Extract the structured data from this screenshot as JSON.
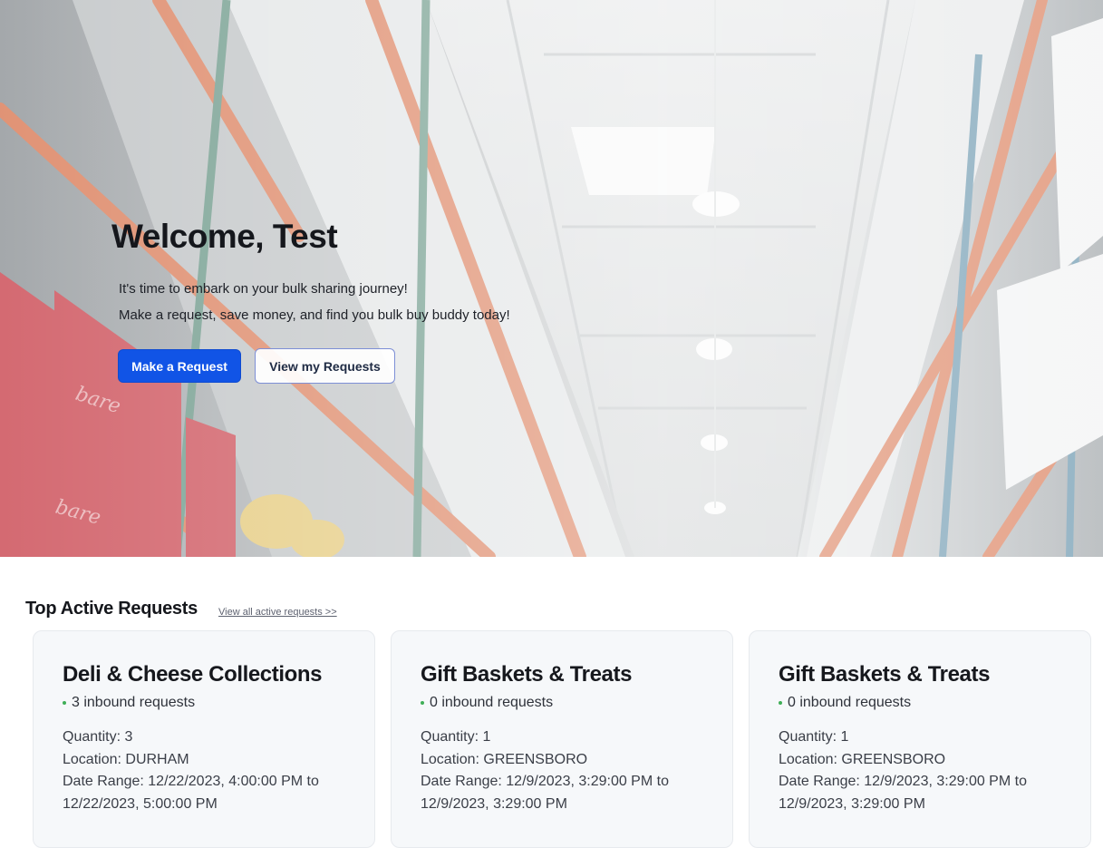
{
  "hero": {
    "welcome": "Welcome, Test",
    "line1": "It's time to embark on your bulk sharing journey!",
    "line2": "Make a request, save money, and find you bulk buy buddy today!",
    "primary_button": "Make a Request",
    "secondary_button": "View my Requests"
  },
  "section": {
    "title": "Top Active Requests",
    "view_all": "View all active requests >>"
  },
  "labels": {
    "quantity": "Quantity: ",
    "location": "Location: ",
    "date_range": "Date Range: "
  },
  "cards": [
    {
      "title": "Deli & Cheese Collections",
      "status": "3 inbound requests",
      "quantity": "3",
      "location": "DURHAM",
      "date_start": "12/22/2023, 4:00:00 PM to",
      "date_end": "12/22/2023, 5:00:00 PM"
    },
    {
      "title": "Gift Baskets & Treats",
      "status": "0 inbound requests",
      "quantity": "1",
      "location": "GREENSBORO",
      "date_start": "12/9/2023, 3:29:00 PM to",
      "date_end": "12/9/2023, 3:29:00 PM"
    },
    {
      "title": "Gift Baskets & Treats",
      "status": "0 inbound requests",
      "quantity": "1",
      "location": "GREENSBORO",
      "date_start": "12/9/2023, 3:29:00 PM to",
      "date_end": "12/9/2023, 3:29:00 PM"
    }
  ],
  "colors": {
    "primary": "#1154e6",
    "status_dot": "#3fae57",
    "card_bg": "#f6f8fa"
  }
}
